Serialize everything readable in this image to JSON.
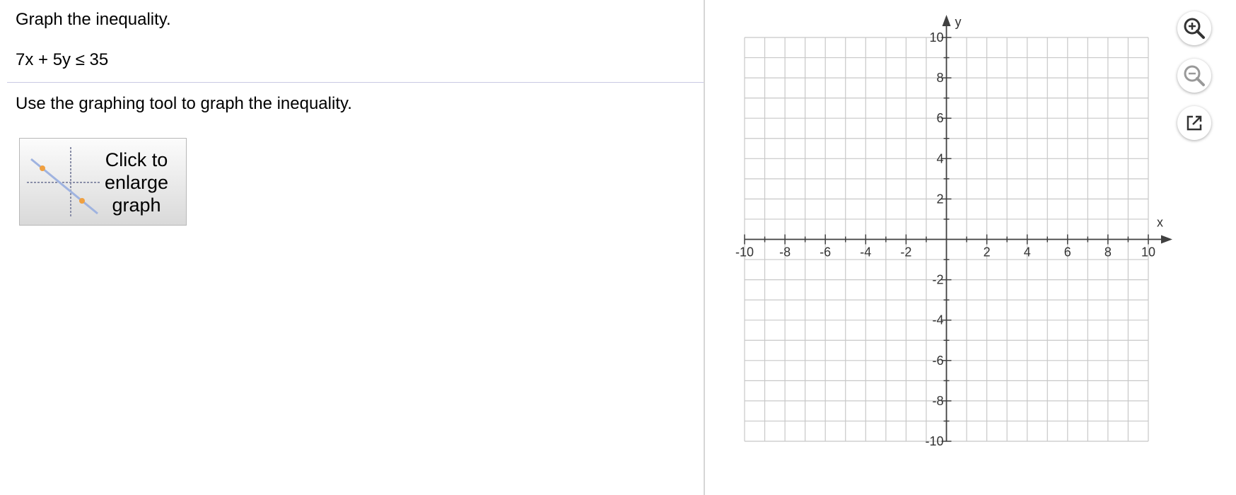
{
  "question": {
    "instruction": "Graph the inequality.",
    "equation": "7x + 5y ≤ 35",
    "prompt": "Use the graphing tool to graph the inequality."
  },
  "enlarge_button": {
    "label": "Click to\nenlarge\ngraph",
    "icon": "graph-thumbnail-icon"
  },
  "graph": {
    "x_axis_label": "x",
    "y_axis_label": "y",
    "x_range": [
      -10,
      10
    ],
    "y_range": [
      -10,
      10
    ],
    "minor_grid_step": 1,
    "major_label_step": 2,
    "x_tick_labels": [
      "-10",
      "-8",
      "-6",
      "-4",
      "-2",
      "2",
      "4",
      "6",
      "8",
      "10"
    ],
    "y_tick_labels": [
      "10",
      "8",
      "6",
      "4",
      "2",
      "-2",
      "-4",
      "-6",
      "-8",
      "-10"
    ],
    "grid": true
  },
  "toolbar": {
    "zoom_in_icon": "zoom-in-icon",
    "zoom_out_icon": "zoom-out-icon",
    "popout_icon": "popout-icon"
  },
  "colors": {
    "grid": "#c8c8c8",
    "axis": "#404040",
    "icon": "#333333",
    "icon_muted": "#999999",
    "thumb_line": "#9fb3e0",
    "thumb_point": "#f0a040"
  }
}
